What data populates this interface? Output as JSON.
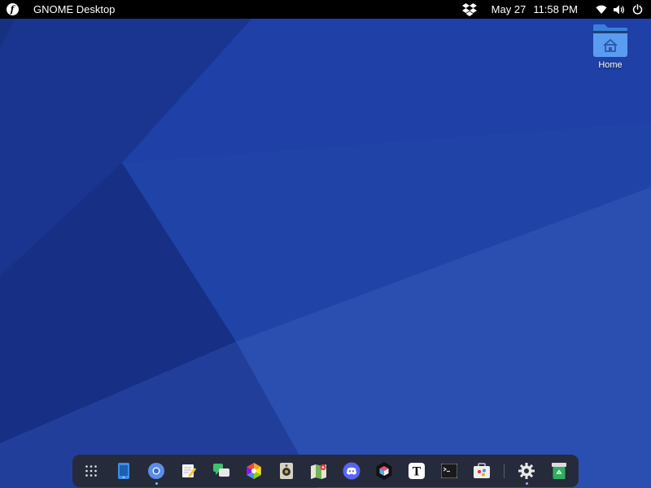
{
  "topbar": {
    "app_name": "GNOME Desktop",
    "date": "May 27",
    "time": "11:58 PM",
    "activities_icon": "fedora-logo-icon",
    "tray_icons": [
      "dropbox-icon",
      "wifi-icon",
      "volume-icon",
      "power-icon"
    ]
  },
  "desktop": {
    "icons": [
      {
        "label": "Home",
        "icon": "home-folder-icon"
      }
    ]
  },
  "dock": {
    "items": [
      {
        "icon": "app-grid-icon",
        "running": false
      },
      {
        "icon": "phone-connect-icon",
        "running": false
      },
      {
        "icon": "chromium-browser-icon",
        "running": true
      },
      {
        "icon": "text-editor-icon",
        "running": false
      },
      {
        "icon": "chat-messages-icon",
        "running": false
      },
      {
        "icon": "color-wheel-icon",
        "running": false
      },
      {
        "icon": "speaker-audio-icon",
        "running": false
      },
      {
        "icon": "maps-icon",
        "running": false
      },
      {
        "icon": "discord-icon",
        "running": false
      },
      {
        "icon": "cube-app-icon",
        "running": false
      },
      {
        "icon": "typora-icon",
        "running": false
      },
      {
        "icon": "terminal-icon",
        "running": false
      },
      {
        "icon": "software-store-icon",
        "running": false
      },
      {
        "icon": "settings-gear-icon",
        "running": true
      },
      {
        "icon": "trash-icon",
        "running": false
      }
    ],
    "typora_glyph": "T"
  },
  "colors": {
    "topbar": "#000000",
    "wallpaper_base": "#1b3a9c",
    "dock_background": "#252b3a",
    "folder_blue": "#4a8fe8"
  }
}
